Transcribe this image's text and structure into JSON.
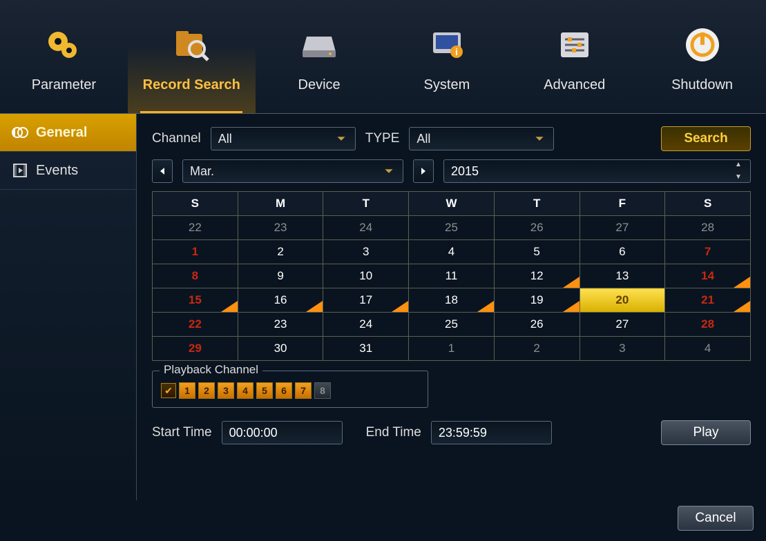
{
  "topnav": [
    {
      "label": "Parameter",
      "icon": "gears"
    },
    {
      "label": "Record Search",
      "icon": "folder-search",
      "active": true
    },
    {
      "label": "Device",
      "icon": "drive"
    },
    {
      "label": "System",
      "icon": "monitor-info"
    },
    {
      "label": "Advanced",
      "icon": "sliders"
    },
    {
      "label": "Shutdown",
      "icon": "power"
    }
  ],
  "sidenav": [
    {
      "label": "General",
      "active": true
    },
    {
      "label": "Events",
      "active": false
    }
  ],
  "filters": {
    "channel_label": "Channel",
    "channel_value": "All",
    "type_label": "TYPE",
    "type_value": "All",
    "search_label": "Search"
  },
  "monthnav": {
    "month": "Mar.",
    "year": "2015"
  },
  "calendar": {
    "dow": [
      "S",
      "M",
      "T",
      "W",
      "T",
      "F",
      "S"
    ],
    "rows": [
      [
        {
          "n": "22",
          "cls": "dim"
        },
        {
          "n": "23",
          "cls": "dim"
        },
        {
          "n": "24",
          "cls": "dim"
        },
        {
          "n": "25",
          "cls": "dim"
        },
        {
          "n": "26",
          "cls": "dim"
        },
        {
          "n": "27",
          "cls": "dim"
        },
        {
          "n": "28",
          "cls": "dim"
        }
      ],
      [
        {
          "n": "1",
          "cls": "sun"
        },
        {
          "n": "2"
        },
        {
          "n": "3"
        },
        {
          "n": "4"
        },
        {
          "n": "5"
        },
        {
          "n": "6"
        },
        {
          "n": "7",
          "cls": "sun"
        }
      ],
      [
        {
          "n": "8",
          "cls": "sun"
        },
        {
          "n": "9"
        },
        {
          "n": "10"
        },
        {
          "n": "11"
        },
        {
          "n": "12",
          "mark": true
        },
        {
          "n": "13"
        },
        {
          "n": "14",
          "cls": "sun",
          "mark": true
        }
      ],
      [
        {
          "n": "15",
          "cls": "sun",
          "mark": true
        },
        {
          "n": "16",
          "mark": true
        },
        {
          "n": "17",
          "mark": true
        },
        {
          "n": "18",
          "mark": true
        },
        {
          "n": "19",
          "mark": true
        },
        {
          "n": "20",
          "cls": "selected"
        },
        {
          "n": "21",
          "cls": "sun",
          "mark": true
        }
      ],
      [
        {
          "n": "22",
          "cls": "sun"
        },
        {
          "n": "23"
        },
        {
          "n": "24"
        },
        {
          "n": "25"
        },
        {
          "n": "26"
        },
        {
          "n": "27"
        },
        {
          "n": "28",
          "cls": "sun"
        }
      ],
      [
        {
          "n": "29",
          "cls": "sun"
        },
        {
          "n": "30"
        },
        {
          "n": "31"
        },
        {
          "n": "1",
          "cls": "dim"
        },
        {
          "n": "2",
          "cls": "dim"
        },
        {
          "n": "3",
          "cls": "dim"
        },
        {
          "n": "4",
          "cls": "dim"
        }
      ]
    ]
  },
  "playback": {
    "legend": "Playback Channel",
    "checked": true,
    "channels": [
      {
        "n": "1",
        "on": true
      },
      {
        "n": "2",
        "on": true
      },
      {
        "n": "3",
        "on": true
      },
      {
        "n": "4",
        "on": true
      },
      {
        "n": "5",
        "on": true
      },
      {
        "n": "6",
        "on": true
      },
      {
        "n": "7",
        "on": true
      },
      {
        "n": "8",
        "on": false
      }
    ]
  },
  "time": {
    "start_label": "Start Time",
    "start_value": "00:00:00",
    "end_label": "End Time",
    "end_value": "23:59:59",
    "play_label": "Play"
  },
  "cancel_label": "Cancel"
}
